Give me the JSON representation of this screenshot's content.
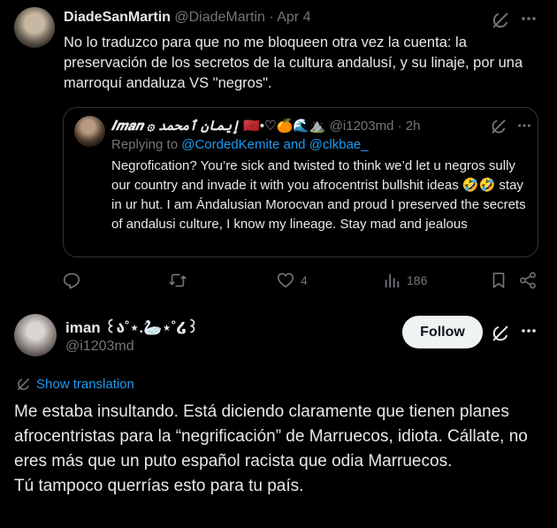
{
  "tweet": {
    "author_name": "DiadeSanMartin",
    "handle": "@DiadeMartin",
    "separator": "·",
    "date": "Apr 4",
    "text": "No lo traduzco para que no me bloqueen otra vez la cuenta: la preservación de los secretos de la cultura andalusí, y su linaje, por una marroquí andaluza VS \"negros\".",
    "quote": {
      "author_name": "𝑰𝒎𝒂𝒏 ۞ إيمان ٱمحمد",
      "emojis": "🇲🇦•♡🍊🌊⛰️",
      "handle": "@i1203md",
      "time": "· 2h",
      "replying_to_prefix": "Replying to",
      "replying_to": "@CordedKemite and @clkbae_",
      "text": "Negrofication? You’re sick and twisted to think we’d let u negros sully our country and invade it with you afrocentrist bullshit ideas 🤣🤣 stay in ur hut. I am Ándalusian Morocvan and proud I preserved the secrets of andalusi culture, I know my lineage. Stay mad and jealous"
    },
    "likes": "4",
    "views": "186"
  },
  "reply": {
    "author_name": "iman ꒰ა˚⋆.🦢⋆˚໒꒱",
    "handle": "@i1203md",
    "follow_label": "Follow",
    "show_translation": "Show translation",
    "paragraphs": [
      "Me estaba insultando. Está diciendo claramente que tienen planes afrocentristas para la “negrificación” de Marruecos, idiota. Cállate, no eres más que un puto español racista que odia Marruecos.",
      "Tú tampoco querrías esto para tu país."
    ]
  },
  "colors": {
    "accent": "#1d9bf0",
    "muted": "#71767b",
    "text": "#e7e9ea",
    "border": "#2f3336"
  }
}
